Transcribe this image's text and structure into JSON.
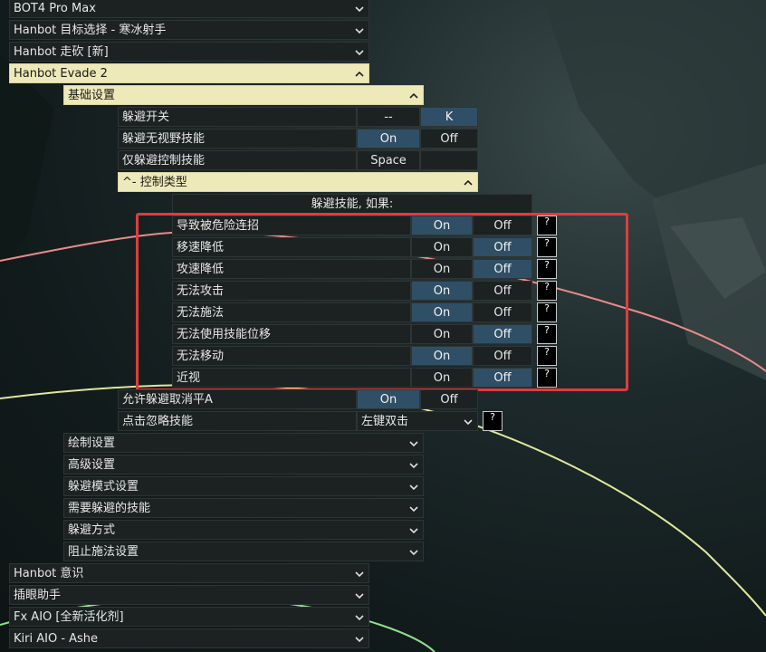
{
  "top_menu": [
    {
      "label": "BOT4 Pro Max",
      "state": "closed"
    },
    {
      "label": "Hanbot 目标选择 - 寒冰射手",
      "state": "closed"
    },
    {
      "label": "Hanbot 走砍 [新]",
      "state": "closed"
    },
    {
      "label": "Hanbot Evade 2",
      "state": "open"
    }
  ],
  "evade": {
    "basic_settings_label": "基础设置",
    "rows": [
      {
        "label": "躲避开关",
        "opt1": "--",
        "opt2": "K",
        "active": 2
      },
      {
        "label": "躲避无视野技能",
        "opt1": "On",
        "opt2": "Off",
        "active": 1
      },
      {
        "label": "仅躲避控制技能",
        "opt1": "Space",
        "opt2": "",
        "active": 0
      }
    ],
    "control_type_label": "^- 控制类型",
    "dodge_if_header": "躲避技能, 如果:",
    "conditions": [
      {
        "label": "导致被危险连招",
        "on": "On",
        "off": "Off",
        "active": "on"
      },
      {
        "label": "移速降低",
        "on": "On",
        "off": "Off",
        "active": "off"
      },
      {
        "label": "攻速降低",
        "on": "On",
        "off": "Off",
        "active": "off"
      },
      {
        "label": "无法攻击",
        "on": "On",
        "off": "Off",
        "active": "on"
      },
      {
        "label": "无法施法",
        "on": "On",
        "off": "Off",
        "active": "on"
      },
      {
        "label": "无法使用技能位移",
        "on": "On",
        "off": "Off",
        "active": "off"
      },
      {
        "label": "无法移动",
        "on": "On",
        "off": "Off",
        "active": "on"
      },
      {
        "label": "近视",
        "on": "On",
        "off": "Off",
        "active": "off"
      }
    ],
    "help_mark": "?",
    "allow_cancel": {
      "label": "允许躲避取消平A",
      "on": "On",
      "off": "Off",
      "active": "on"
    },
    "click_ignore": {
      "label": "点击忽略技能",
      "value": "左键双击"
    },
    "submenus": [
      "绘制设置",
      "高级设置",
      "躲避模式设置",
      "需要躲避的技能",
      "躲避方式",
      "阻止施法设置"
    ]
  },
  "bottom_menu": [
    {
      "label": "Hanbot 意识"
    },
    {
      "label": "插眼助手"
    },
    {
      "label": "Fx AIO [全新活化剂]"
    },
    {
      "label": "Kiri AIO - Ashe"
    }
  ],
  "icons": {
    "collapse": "chevron-down-icon",
    "expand": "chevron-up-icon",
    "help": "question-mark-icon"
  },
  "colors": {
    "open_header": "#eee9b8",
    "active_toggle": "#2f4f66",
    "highlight_box": "#e23b3b"
  }
}
